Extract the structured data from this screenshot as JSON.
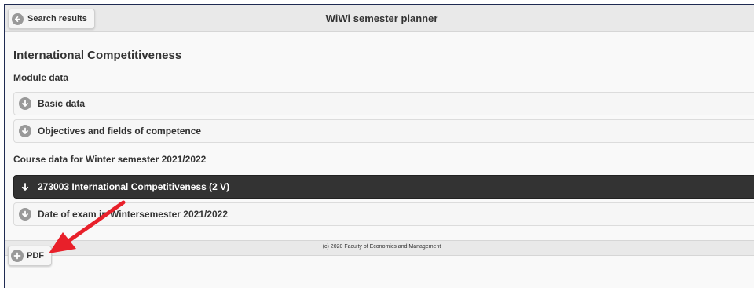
{
  "header": {
    "back_label": "Search results",
    "app_title": "WiWi semester planner"
  },
  "module": {
    "title": "International Competitiveness",
    "module_data_heading": "Module data",
    "sections": [
      {
        "label": "Basic data"
      },
      {
        "label": "Objectives and fields of competence"
      }
    ],
    "course_heading": "Course data for Winter semester 2021/2022",
    "course_items": [
      {
        "label": "273003 International Competitiveness (2 V)",
        "expanded": true
      },
      {
        "label": "Date of exam in Wintersemester 2021/2022",
        "expanded": false
      }
    ]
  },
  "footer": {
    "copyright": "(c) 2020 Faculty of Economics and Management"
  },
  "pdf_button": {
    "label": "PDF"
  },
  "colors": {
    "frame_border": "#1f2b52",
    "bar_background": "#e9e9e9",
    "expanded_item_background": "#333333",
    "annotation_arrow": "#e8202a"
  },
  "icons": {
    "back": "arrow-left-circle-icon",
    "collapsed": "arrow-down-circle-icon",
    "expanded": "arrow-down-icon",
    "pdf": "plus-circle-icon"
  }
}
